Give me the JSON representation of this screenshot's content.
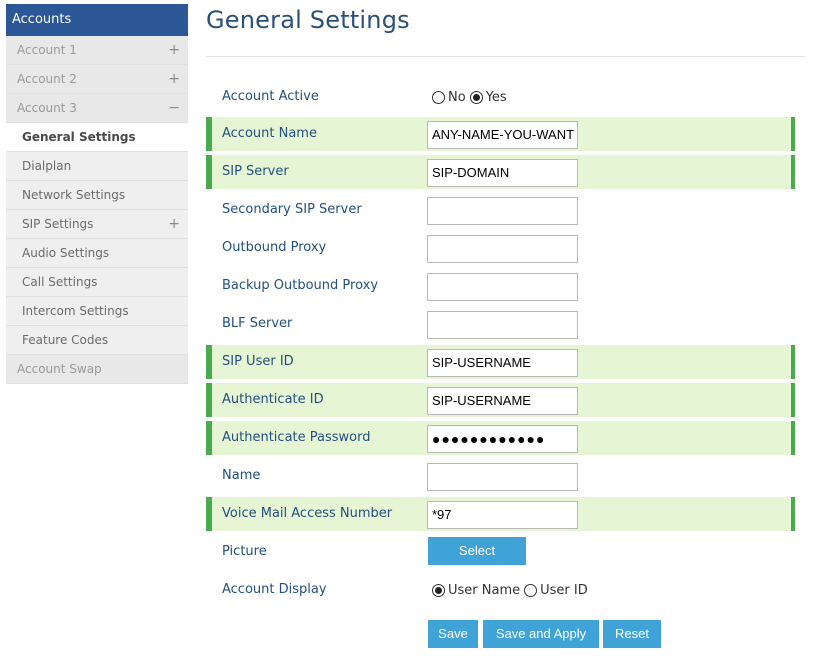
{
  "sidebar": {
    "header": "Accounts",
    "items": [
      {
        "label": "Account 1",
        "symbol": "+"
      },
      {
        "label": "Account 2",
        "symbol": "+"
      },
      {
        "label": "Account 3",
        "symbol": "−"
      },
      {
        "label": "General Settings",
        "symbol": ""
      },
      {
        "label": "Dialplan",
        "symbol": ""
      },
      {
        "label": "Network Settings",
        "symbol": ""
      },
      {
        "label": "SIP Settings",
        "symbol": "+"
      },
      {
        "label": "Audio Settings",
        "symbol": ""
      },
      {
        "label": "Call Settings",
        "symbol": ""
      },
      {
        "label": "Intercom Settings",
        "symbol": ""
      },
      {
        "label": "Feature Codes",
        "symbol": ""
      },
      {
        "label": "Account Swap",
        "symbol": ""
      }
    ]
  },
  "page": {
    "title": "General Settings"
  },
  "form": {
    "account_active": {
      "label": "Account Active",
      "options": [
        "No",
        "Yes"
      ],
      "selected": "Yes"
    },
    "account_name": {
      "label": "Account Name",
      "value": "ANY-NAME-YOU-WANT"
    },
    "sip_server": {
      "label": "SIP Server",
      "value": "SIP-DOMAIN"
    },
    "secondary_sip_server": {
      "label": "Secondary SIP Server",
      "value": ""
    },
    "outbound_proxy": {
      "label": "Outbound Proxy",
      "value": ""
    },
    "backup_outbound_proxy": {
      "label": "Backup Outbound Proxy",
      "value": ""
    },
    "blf_server": {
      "label": "BLF Server",
      "value": ""
    },
    "sip_user_id": {
      "label": "SIP User ID",
      "value": "SIP-USERNAME"
    },
    "authenticate_id": {
      "label": "Authenticate ID",
      "value": "SIP-USERNAME"
    },
    "authenticate_password": {
      "label": "Authenticate Password",
      "value": "●●●●●●●●●●●●"
    },
    "name": {
      "label": "Name",
      "value": ""
    },
    "voice_mail_access_number": {
      "label": "Voice Mail Access Number",
      "value": "*97"
    },
    "picture": {
      "label": "Picture",
      "button": "Select"
    },
    "account_display": {
      "label": "Account Display",
      "options": [
        "User Name",
        "User ID"
      ],
      "selected": "User Name"
    }
  },
  "actions": {
    "save": "Save",
    "save_apply": "Save and Apply",
    "reset": "Reset"
  },
  "colors": {
    "sidebar_header": "#2b5797",
    "highlight_bg": "#e6f5d4",
    "highlight_border": "#4aaa50",
    "button": "#3fa3d8",
    "title": "#2b5078"
  }
}
